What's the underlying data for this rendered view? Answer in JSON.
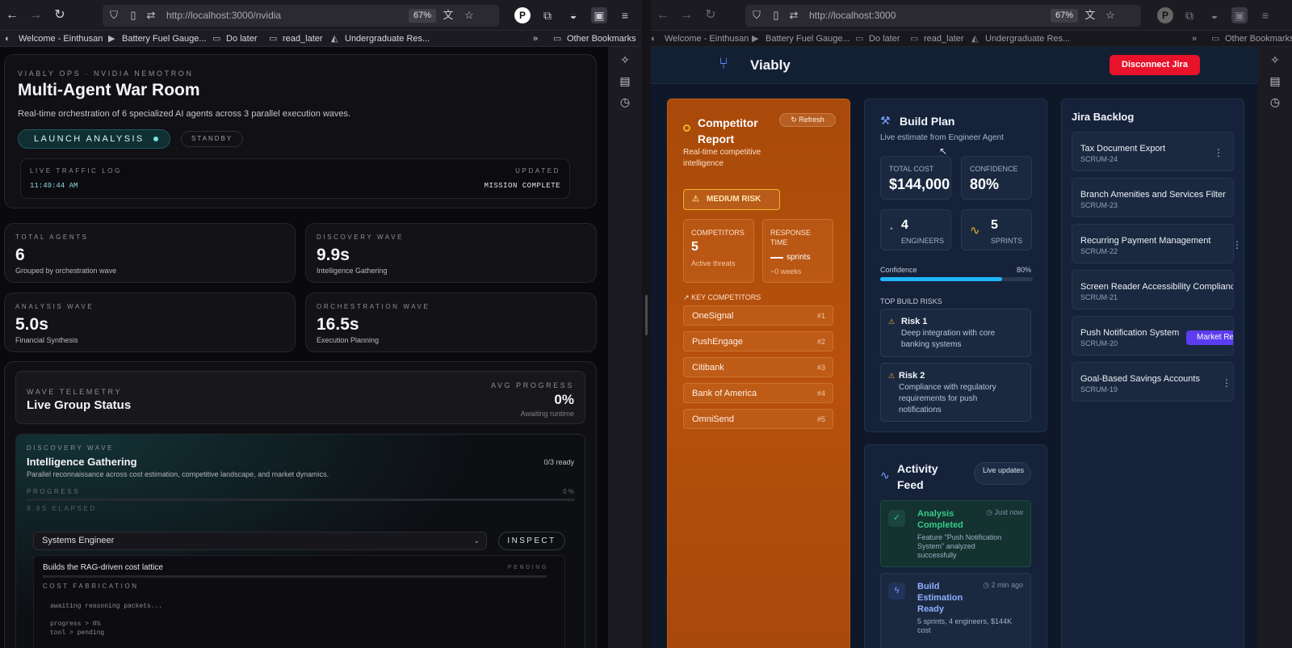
{
  "browser_chrome": {
    "left_url": "http://localhost:3000/nvidia",
    "right_url": "http://localhost:3000",
    "zoom": "67%",
    "bookmarks": [
      "Welcome - Einthusan",
      "Battery Fuel Gauge...",
      "Do later",
      "read_later",
      "Undergraduate Res..."
    ],
    "other_bookmarks": "Other Bookmarks"
  },
  "war_room": {
    "eyebrow": "VIABLY OPS · NVIDIA NEMOTRON",
    "title": "Multi-Agent War Room",
    "subtitle": "Real-time orchestration of 6 specialized AI agents across 3 parallel execution waves.",
    "launch_label": "LAUNCH ANALYSIS",
    "standby_label": "STANDBY",
    "traffic_log": {
      "label": "LIVE TRAFFIC LOG",
      "time": "11:49:44 AM",
      "updated_label": "UPDATED",
      "status": "MISSION COMPLETE"
    },
    "stats": [
      {
        "label": "TOTAL AGENTS",
        "value": "6",
        "desc": "Grouped by orchestration wave"
      },
      {
        "label": "DISCOVERY WAVE",
        "value": "9.9s",
        "desc": "Intelligence Gathering"
      },
      {
        "label": "ANALYSIS WAVE",
        "value": "5.0s",
        "desc": "Financial Synthesis"
      },
      {
        "label": "ORCHESTRATION WAVE",
        "value": "16.5s",
        "desc": "Execution Planning"
      }
    ],
    "telemetry": {
      "eyebrow": "WAVE TELEMETRY",
      "title": "Live Group Status",
      "avg_label": "AVG PROGRESS",
      "avg_value": "0%",
      "avg_sub": "Awaiting runtime"
    },
    "wave": {
      "eyebrow": "DISCOVERY WAVE",
      "title": "Intelligence Gathering",
      "desc": "Parallel reconnaissance across cost estimation, competitive landscape, and market dynamics.",
      "ready": "0/3 ready",
      "progress_label": "PROGRESS",
      "progress_value": "0 %",
      "elapsed": "9.9S ELAPSED"
    },
    "agent": {
      "selected": "Systems Engineer",
      "inspect_label": "INSPECT",
      "task": "Builds the RAG-driven cost lattice",
      "state": "PENDING",
      "section": "COST FABRICATION",
      "log": [
        "awaiting reasoning packets...",
        "progress > 0%",
        "tool > pending"
      ]
    }
  },
  "viably": {
    "brand": "Viably",
    "disconnect_label": "Disconnect Jira",
    "competitor": {
      "title": "Competitor Report",
      "refresh_label": "Refresh",
      "subtitle": "Real-time competitive intelligence",
      "risk_label": "MEDIUM RISK",
      "competitors_label": "COMPETITORS",
      "competitors_value": "5",
      "competitors_sub": "Active threats",
      "response_label": "RESPONSE TIME",
      "response_value": "sprints",
      "response_sub": "~0 weeks",
      "key_label": "KEY COMPETITORS",
      "list": [
        {
          "name": "OneSignal",
          "rank": "#1"
        },
        {
          "name": "PushEngage",
          "rank": "#2"
        },
        {
          "name": "Citibank",
          "rank": "#3"
        },
        {
          "name": "Bank of America",
          "rank": "#4"
        },
        {
          "name": "OmniSend",
          "rank": "#5"
        }
      ]
    },
    "build_plan": {
      "title": "Build Plan",
      "subtitle": "Live estimate from Engineer Agent",
      "total_cost_label": "TOTAL COST",
      "total_cost": "$144,000",
      "confidence_label": "CONFIDENCE",
      "confidence": "80%",
      "engineers_value": "4",
      "engineers_label": "ENGINEERS",
      "sprints_value": "5",
      "sprints_label": "SPRINTS",
      "bar_label": "Confidence",
      "bar_value": "80%",
      "bar_fraction": 0.8,
      "risks_label": "TOP BUILD RISKS",
      "risks": [
        {
          "title": "Risk 1",
          "desc": "Deep integration with core banking systems"
        },
        {
          "title": "Risk 2",
          "desc": "Compliance with regulatory requirements for push notifications"
        }
      ]
    },
    "activity": {
      "title": "Activity Feed",
      "badge": "Live updates",
      "items": [
        {
          "title": "Analysis Completed",
          "time": "Just now",
          "desc": "Feature \"Push Notification System\" analyzed successfully"
        },
        {
          "title": "Build Estimation Ready",
          "time": "2 min ago",
          "desc": "5 sprints, 4 engineers, $144K cost"
        }
      ]
    },
    "jira": {
      "title": "Jira Backlog",
      "drag_chip": "Market Re",
      "items": [
        {
          "name": "Tax Document Export",
          "key": "SCRUM-24"
        },
        {
          "name": "Branch Amenities and Services Filter",
          "key": "SCRUM-23"
        },
        {
          "name": "Recurring Payment Management",
          "key": "SCRUM-22"
        },
        {
          "name": "Screen Reader Accessibility Compliance",
          "key": "SCRUM-21"
        },
        {
          "name": "Push Notification System",
          "key": "SCRUM-20"
        },
        {
          "name": "Goal-Based Savings Accounts",
          "key": "SCRUM-19"
        }
      ]
    }
  },
  "colors": {
    "accent_teal": "#6fe7e0",
    "progress_blue": "#1fb6ff",
    "disconnect_red": "#e8122b",
    "competitor_orange": "#b7510c",
    "risk_yellow": "#f0b429",
    "success_green": "#37c98a",
    "drag_purple": "#5b3cf0"
  }
}
